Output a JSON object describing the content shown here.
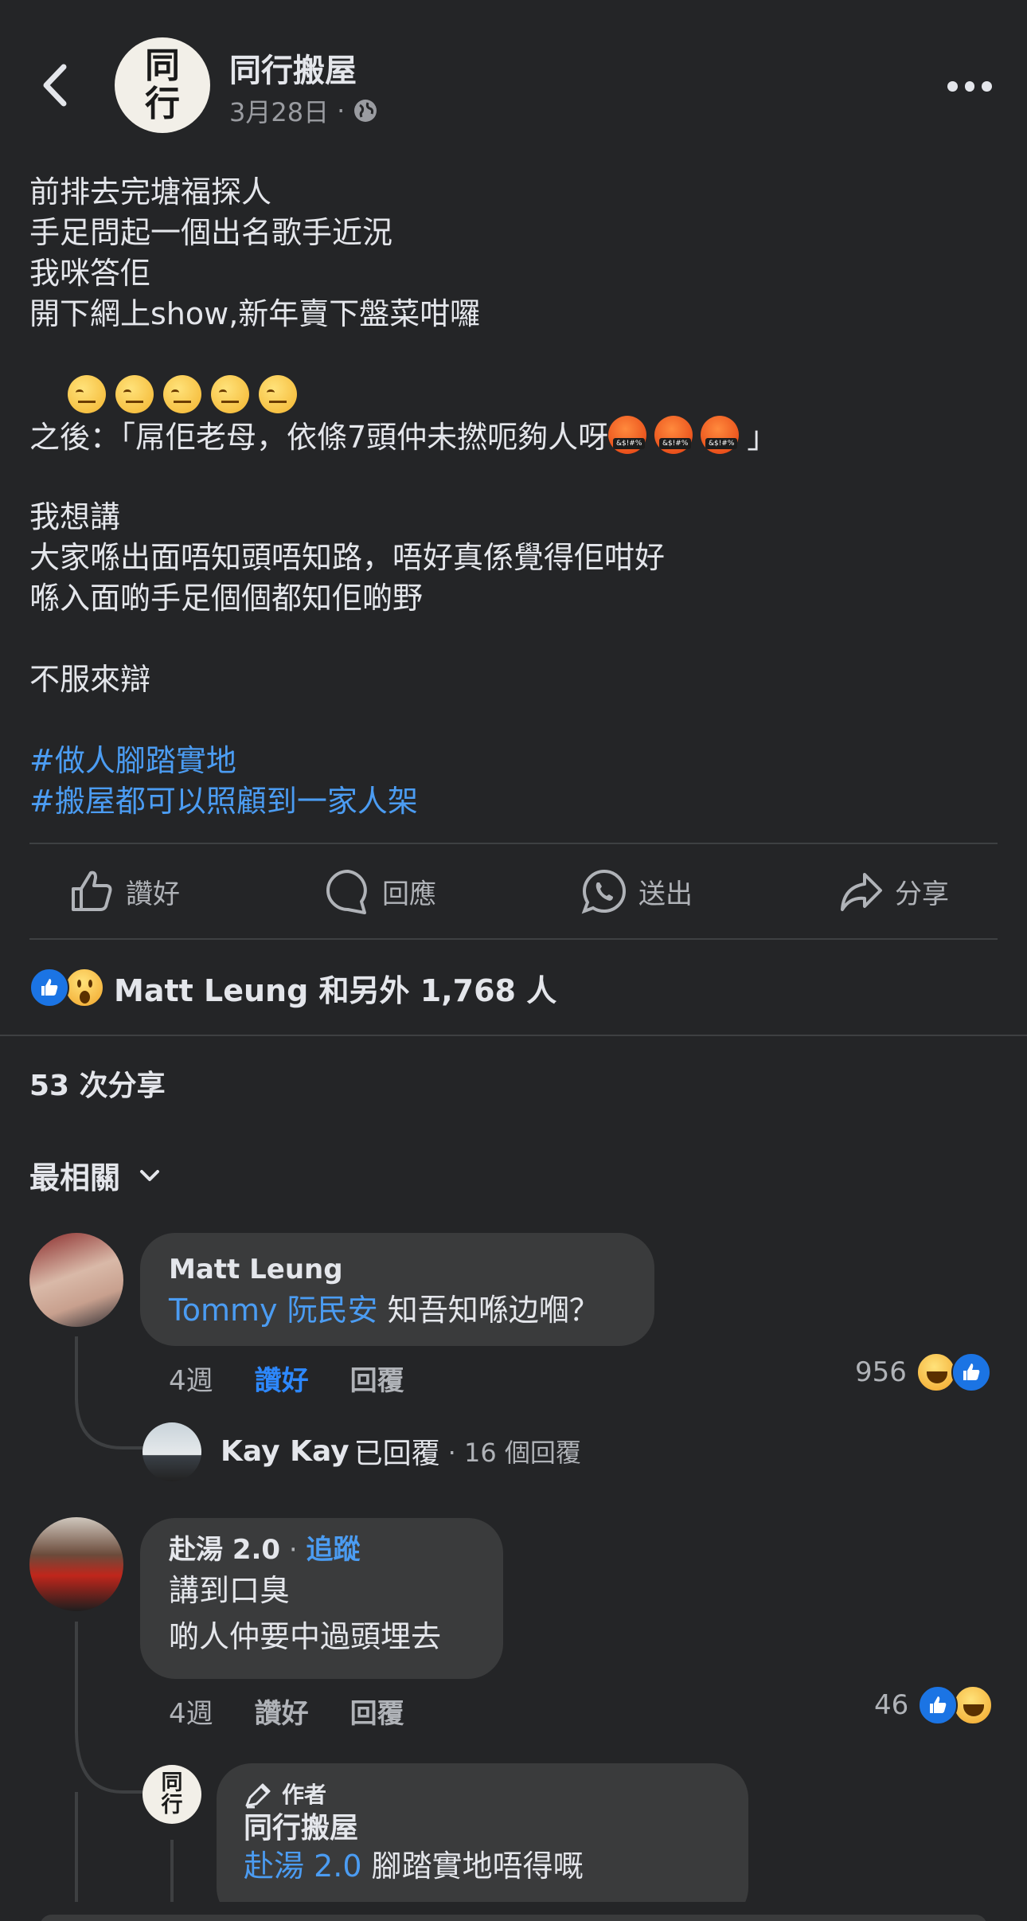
{
  "header": {
    "page_name": "同行搬屋",
    "avatar_line1": "同",
    "avatar_line2": "行",
    "date": "3月28日",
    "dot": "·"
  },
  "post": {
    "lines": [
      "前排去完塘福探人",
      "手足問起一個出名歌手近況",
      "我咪答佢",
      "開下網上show,新年賣下盤菜咁囉"
    ],
    "line_after": "之後：「屌佢老母，依條7頭仲未撚呃夠人呀",
    "line_after_close": "」",
    "lines2": [
      "我想講",
      "大家喺出面唔知頭唔知路，唔好真係覺得佢咁好",
      "喺入面啲手足個個都知佢啲野"
    ],
    "closing": "不服來辯",
    "hashtags": [
      "#做人腳踏實地",
      "#搬屋都可以照顧到一家人架"
    ]
  },
  "actions": {
    "like": "讚好",
    "comment": "回應",
    "send": "送出",
    "share": "分享"
  },
  "reactions": {
    "summary": "Matt Leung 和另外 1,768 人"
  },
  "shares": "53 次分享",
  "sort": {
    "label": "最相關"
  },
  "comments": [
    {
      "name": "Matt Leung",
      "mention": "Tommy 阮民安",
      "text": " 知吾知喺边嗰？",
      "time": "4週",
      "like": "讚好",
      "reply": "回覆",
      "count": "956"
    },
    {
      "name": "赴湯 2.0",
      "follow_sep": " · ",
      "follow": "追蹤",
      "line1": "講到口臭",
      "line2": "啲人仲要中過頭埋去",
      "time": "4週",
      "like": "讚好",
      "reply": "回覆",
      "count": "46"
    }
  ],
  "replies_summary": {
    "name": "Kay Kay",
    "action": "已回覆",
    "count": "· 16 個回覆"
  },
  "author_reply": {
    "badge": "作者",
    "name": "同行搬屋",
    "mention": "赴湯 2.0",
    "text": " 腳踏實地唔得嘅",
    "avatar_line1": "同",
    "avatar_line2": "行"
  },
  "colors": {
    "background": "#242527",
    "bubble": "#3a3b3c",
    "link": "#4b9cf2",
    "like_active": "#2d88ff"
  }
}
